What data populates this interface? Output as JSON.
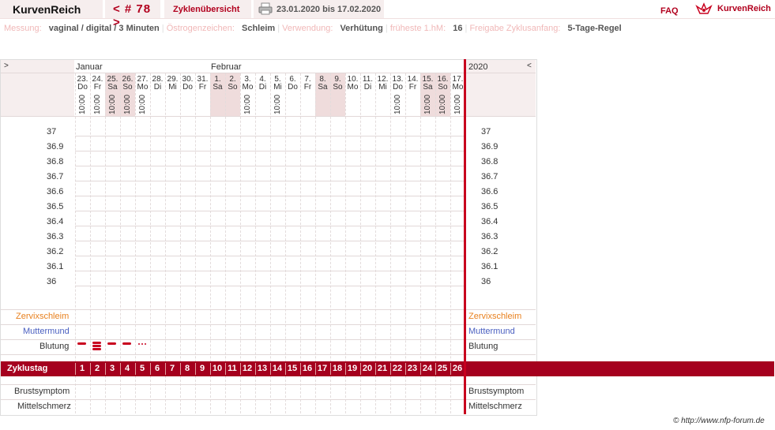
{
  "header": {
    "logo_text": "KurvenReich",
    "cycle_number": "< # 78 >",
    "cycles_overview": "Zyklenübersicht",
    "date_range": "23.01.2020 bis 17.02.2020",
    "faq": "FAQ",
    "brand": "KurvenReich"
  },
  "info": {
    "messung_label": "Messung:",
    "messung_value": "vaginal / digital / 3 Minuten",
    "oestrogen_label": "Östrogenzeichen:",
    "oestrogen_value": "Schleim",
    "verwendung_label": "Verwendung:",
    "verwendung_value": "Verhütung",
    "frueheste_label": "früheste 1.hM:",
    "frueheste_value": "16",
    "freigabe_label": "Freigabe Zyklusanfang:",
    "freigabe_value": "5-Tage-Regel"
  },
  "chart": {
    "left_arrow": ">",
    "right_arrow": "<",
    "month_january": "Januar",
    "month_february": "Februar",
    "year": "2020",
    "days": [
      {
        "d": "23.",
        "w": "Do",
        "t": "10:00",
        "wk": false
      },
      {
        "d": "24.",
        "w": "Fr",
        "t": "10:00",
        "wk": false
      },
      {
        "d": "25.",
        "w": "Sa",
        "t": "10:00",
        "wk": true
      },
      {
        "d": "26.",
        "w": "So",
        "t": "10:00",
        "wk": true
      },
      {
        "d": "27.",
        "w": "Mo",
        "t": "10:00",
        "wk": false
      },
      {
        "d": "28.",
        "w": "Di",
        "t": "",
        "wk": false
      },
      {
        "d": "29.",
        "w": "Mi",
        "t": "",
        "wk": false
      },
      {
        "d": "30.",
        "w": "Do",
        "t": "",
        "wk": false
      },
      {
        "d": "31.",
        "w": "Fr",
        "t": "",
        "wk": false
      },
      {
        "d": "1.",
        "w": "Sa",
        "t": "",
        "wk": true
      },
      {
        "d": "2.",
        "w": "So",
        "t": "",
        "wk": true
      },
      {
        "d": "3.",
        "w": "Mo",
        "t": "10:00",
        "wk": false
      },
      {
        "d": "4.",
        "w": "Di",
        "t": "",
        "wk": false
      },
      {
        "d": "5.",
        "w": "Mi",
        "t": "10:00",
        "wk": false
      },
      {
        "d": "6.",
        "w": "Do",
        "t": "",
        "wk": false
      },
      {
        "d": "7.",
        "w": "Fr",
        "t": "",
        "wk": false
      },
      {
        "d": "8.",
        "w": "Sa",
        "t": "",
        "wk": true
      },
      {
        "d": "9.",
        "w": "So",
        "t": "",
        "wk": true
      },
      {
        "d": "10.",
        "w": "Mo",
        "t": "",
        "wk": false
      },
      {
        "d": "11.",
        "w": "Di",
        "t": "",
        "wk": false
      },
      {
        "d": "12.",
        "w": "Mi",
        "t": "",
        "wk": false
      },
      {
        "d": "13.",
        "w": "Do",
        "t": "10:00",
        "wk": false
      },
      {
        "d": "14.",
        "w": "Fr",
        "t": "",
        "wk": false
      },
      {
        "d": "15.",
        "w": "Sa",
        "t": "10:00",
        "wk": true
      },
      {
        "d": "16.",
        "w": "So",
        "t": "10:00",
        "wk": true
      },
      {
        "d": "17.",
        "w": "Mo",
        "t": "10:00",
        "wk": false
      }
    ],
    "temps": [
      "37",
      "36.9",
      "36.8",
      "36.7",
      "36.6",
      "36.5",
      "36.4",
      "36.3",
      "36.2",
      "36.1",
      "36"
    ],
    "rows": {
      "zervix": "Zervixschleim",
      "muttermund": "Muttermund",
      "blutung": "Blutung",
      "zyklustag": "Zyklustag",
      "brust": "Brustsymptom",
      "mittel": "Mittelschmerz"
    },
    "cycle_days": [
      "1",
      "2",
      "3",
      "4",
      "5",
      "6",
      "7",
      "8",
      "9",
      "10",
      "11",
      "12",
      "13",
      "14",
      "15",
      "16",
      "17",
      "18",
      "19",
      "20",
      "21",
      "22",
      "23",
      "24",
      "25",
      "26"
    ],
    "bleeding": [
      {
        "day": 1,
        "level": "normal"
      },
      {
        "day": 2,
        "level": "heavy"
      },
      {
        "day": 3,
        "level": "normal"
      },
      {
        "day": 4,
        "level": "normal"
      },
      {
        "day": 5,
        "level": "spotting"
      }
    ]
  },
  "footer": {
    "copyright": "© http://www.nfp-forum.de"
  },
  "colors": {
    "accent": "#b2001e",
    "zervix": "#e8801e",
    "muttermund": "#4a5fc0"
  }
}
